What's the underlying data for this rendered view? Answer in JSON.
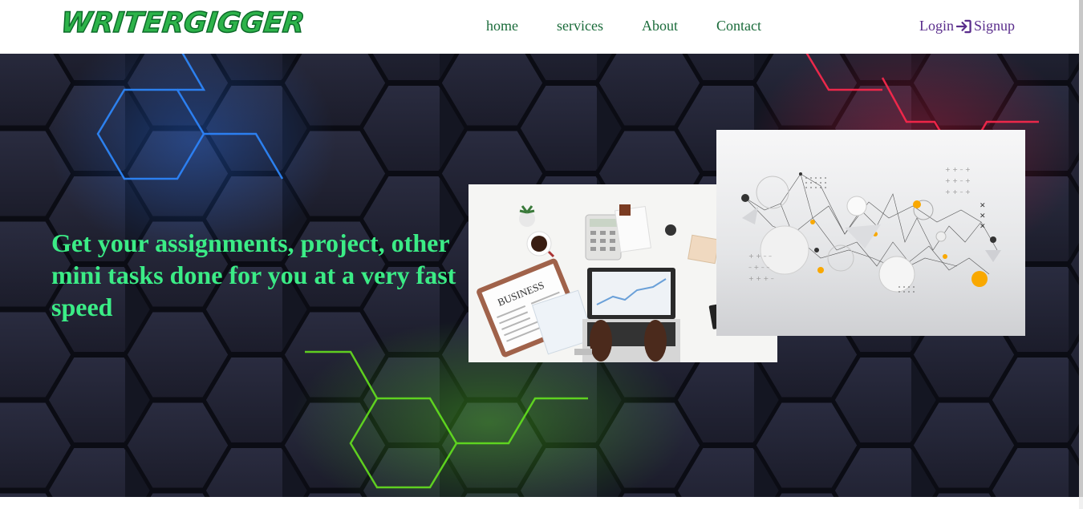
{
  "brand": {
    "logo_text": "WRITERGIGGER"
  },
  "nav": {
    "links": [
      "home",
      "services",
      "About",
      "Contact"
    ],
    "login_label": "Login",
    "signup_label": "Signup"
  },
  "hero": {
    "headline": "Get your assignments, project, other mini tasks done for you at a very fast speed",
    "colors": {
      "headline": "#3bec86",
      "background": "#141622"
    }
  },
  "images": {
    "desk_card": {
      "label": "BUSINESS"
    }
  }
}
